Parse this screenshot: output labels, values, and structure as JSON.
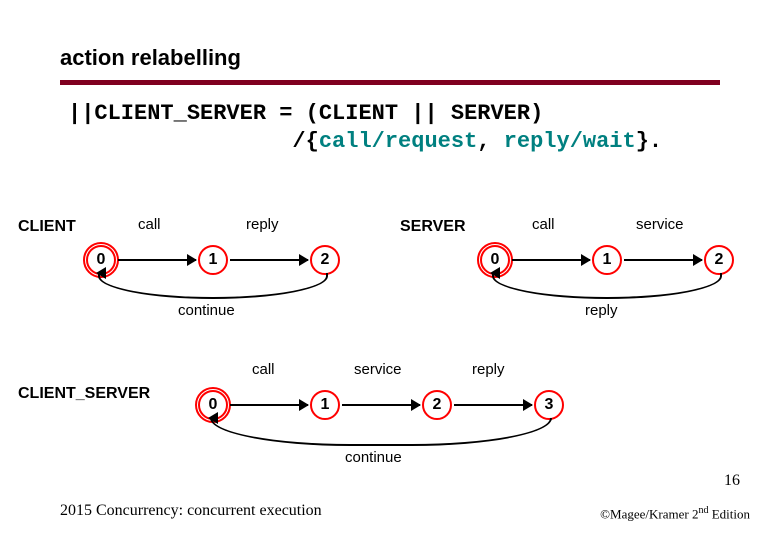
{
  "title": "action relabelling",
  "code": {
    "line1_plain": "||CLIENT_SERVER = (CLIENT || SERVER)",
    "line2_prefix": "                 /{",
    "line2_mid1": "call/request",
    "line2_join": ", ",
    "line2_mid2": "reply/wait",
    "line2_suffix": "}."
  },
  "page_number": "16",
  "footer_left": "2015  Concurrency: concurrent execution",
  "footer_attr_prefix": "©Magee/Kramer ",
  "footer_attr_edition_num": "2",
  "footer_attr_edition_sup": "nd",
  "footer_attr_edition_suffix": " Edition",
  "diagrams": {
    "client": {
      "label": "CLIENT",
      "states": [
        "0",
        "1",
        "2"
      ],
      "top_labels": [
        "call",
        "reply"
      ],
      "bottom_label": "continue"
    },
    "server": {
      "label": "SERVER",
      "states": [
        "0",
        "1",
        "2"
      ],
      "top_labels": [
        "call",
        "service"
      ],
      "bottom_label": "reply"
    },
    "client_server": {
      "label": "CLIENT_SERVER",
      "states": [
        "0",
        "1",
        "2",
        "3"
      ],
      "top_labels": [
        "call",
        "service",
        "reply"
      ],
      "bottom_label": "continue"
    }
  }
}
